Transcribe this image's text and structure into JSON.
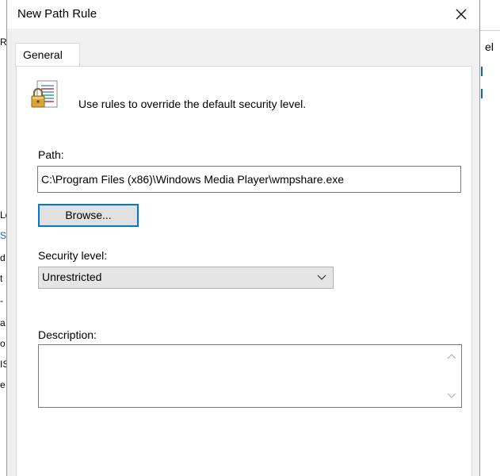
{
  "background": {
    "fragments_left": [
      "R",
      "Lc",
      "S",
      "d",
      "t",
      "-",
      "a",
      "o",
      "IS",
      "e"
    ],
    "fragment_right": "el"
  },
  "dialog": {
    "title": "New Path Rule",
    "close_glyph": "✕",
    "tabs": [
      {
        "label": "General",
        "selected": true
      }
    ],
    "intro_text": "Use rules to override the default security level.",
    "path": {
      "label": "Path:",
      "value": "C:\\Program Files (x86)\\Windows Media Player\\wmpshare.exe"
    },
    "browse_button": "Browse...",
    "security_level": {
      "label": "Security level:",
      "selected": "Unrestricted"
    },
    "description": {
      "label": "Description:",
      "value": ""
    }
  },
  "icons": {
    "intro": "rule-document-lock-icon",
    "close": "close-icon",
    "dropdown": "chevron-down-icon",
    "scroll_up": "scroll-up-icon",
    "scroll_down": "scroll-down-icon"
  },
  "colors": {
    "focus_border": "#0078d7",
    "dialog_bg": "#f0f0f0",
    "panel_bg": "#ffffff",
    "combo_bg": "#e5e5e5"
  }
}
